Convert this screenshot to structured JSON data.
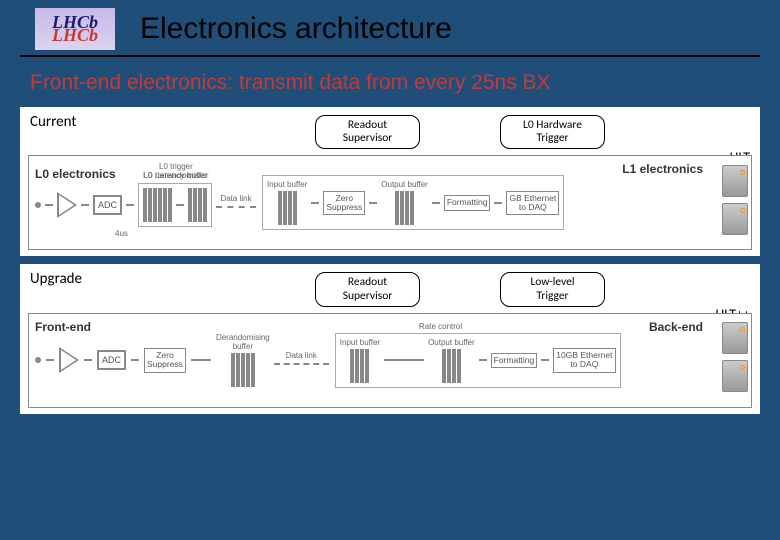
{
  "title": "Electronics architecture",
  "subtitle": "Front-end electronics: transmit data from every 25ns BX",
  "logo": {
    "top": "LHCb",
    "bottom": "LHCb"
  },
  "panels": {
    "current": {
      "label": "Current",
      "supervisor": "Readout\nSupervisor",
      "trigger": "L0 Hardware\nTrigger",
      "hlt": "HLT",
      "diagram": {
        "left_title": "L0 electronics",
        "right_title": "L1 electronics",
        "adc": "ADC",
        "l0_trigger_top": "L0 trigger",
        "l0_latency": "L0 Latency buffer",
        "l0_derand": "L0 derandomiser",
        "l0_time": "4us",
        "data_link": "Data link",
        "input_buf": "Input buffer",
        "output_buf": "Output buffer",
        "zero": "Zero\nSuppress",
        "format": "Formatting",
        "eth": "GB Ethernet\nto DAQ"
      }
    },
    "upgrade": {
      "label": "Upgrade",
      "supervisor": "Readout\nSupervisor",
      "trigger": "Low-level\nTrigger",
      "hlt": "HLT++",
      "diagram": {
        "left_title": "Front-end",
        "right_title": "Back-end",
        "adc": "ADC",
        "derand_top": "Derandomising\nbuffer",
        "zero": "Zero\nSuppress",
        "data_link": "Data link",
        "rate_ctrl": "Rate control",
        "input_buf": "Input buffer",
        "output_buf": "Output buffer",
        "format": "Formatting",
        "eth": "10GB Ethernet\nto DAQ"
      }
    }
  }
}
